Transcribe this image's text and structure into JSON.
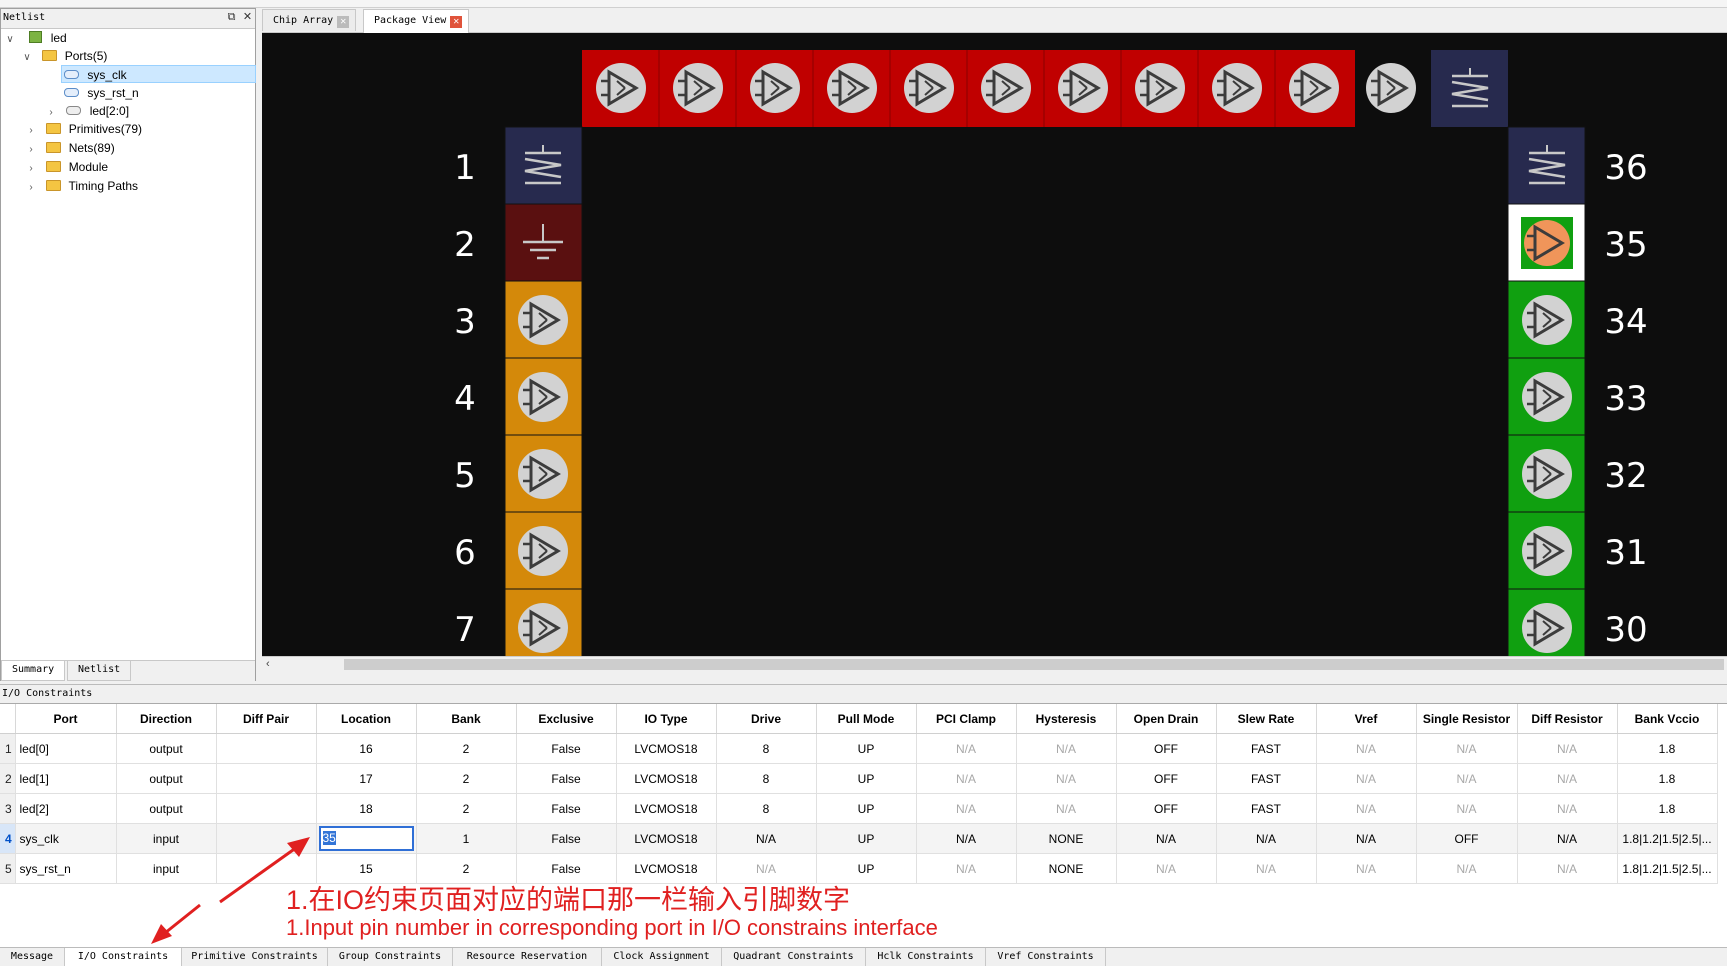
{
  "netlist": {
    "title": "Netlist",
    "tree": [
      {
        "label": "led",
        "icon": "chip-icon"
      },
      {
        "label": "Ports(5)",
        "icon": "folder-icon"
      },
      {
        "label": "sys_clk",
        "icon": "port-icon"
      },
      {
        "label": "sys_rst_n",
        "icon": "port-icon"
      },
      {
        "label": "led[2:0]",
        "icon": "bus-port-icon"
      },
      {
        "label": "Primitives(79)",
        "icon": "folder-icon"
      },
      {
        "label": "Nets(89)",
        "icon": "folder-icon"
      },
      {
        "label": "Module",
        "icon": "folder-icon"
      },
      {
        "label": "Timing Paths",
        "icon": "folder-icon"
      }
    ],
    "tabs": [
      "Summary",
      "Netlist"
    ]
  },
  "view_tabs": [
    "Chip Array",
    "Package View"
  ],
  "package": {
    "left_pins": [
      "1",
      "2",
      "3",
      "4",
      "5",
      "6",
      "7"
    ],
    "right_pins": [
      "36",
      "35",
      "34",
      "33",
      "32",
      "31",
      "30"
    ],
    "colors": {
      "top_io": "#c00000",
      "left_io": "#d4890a",
      "right_io": "#10a010",
      "power": "#272a4e",
      "ground": "#5a1010",
      "selected": "#ffffff",
      "selected_icon": "#f0955a"
    }
  },
  "io": {
    "title": "I/O Constraints",
    "columns": [
      "Port",
      "Direction",
      "Diff Pair",
      "Location",
      "Bank",
      "Exclusive",
      "IO Type",
      "Drive",
      "Pull Mode",
      "PCI Clamp",
      "Hysteresis",
      "Open Drain",
      "Slew Rate",
      "Vref",
      "Single Resistor",
      "Diff Resistor",
      "Bank Vccio"
    ],
    "rows": [
      {
        "num": "1",
        "cells": [
          "led[0]",
          "output",
          "",
          "16",
          "2",
          "False",
          "LVCMOS18",
          "8",
          "UP",
          "N/A",
          "N/A",
          "OFF",
          "FAST",
          "N/A",
          "N/A",
          "N/A",
          "1.8"
        ]
      },
      {
        "num": "2",
        "cells": [
          "led[1]",
          "output",
          "",
          "17",
          "2",
          "False",
          "LVCMOS18",
          "8",
          "UP",
          "N/A",
          "N/A",
          "OFF",
          "FAST",
          "N/A",
          "N/A",
          "N/A",
          "1.8"
        ]
      },
      {
        "num": "3",
        "cells": [
          "led[2]",
          "output",
          "",
          "18",
          "2",
          "False",
          "LVCMOS18",
          "8",
          "UP",
          "N/A",
          "N/A",
          "OFF",
          "FAST",
          "N/A",
          "N/A",
          "N/A",
          "1.8"
        ]
      },
      {
        "num": "4",
        "cells": [
          "sys_clk",
          "input",
          "",
          "35",
          "1",
          "False",
          "LVCMOS18",
          "N/A",
          "UP",
          "N/A",
          "NONE",
          "N/A",
          "N/A",
          "N/A",
          "OFF",
          "N/A",
          "1.8|1.2|1.5|2.5|..."
        ]
      },
      {
        "num": "5",
        "cells": [
          "sys_rst_n",
          "input",
          "",
          "15",
          "2",
          "False",
          "LVCMOS18",
          "N/A",
          "UP",
          "N/A",
          "NONE",
          "N/A",
          "N/A",
          "N/A",
          "N/A",
          "N/A",
          "1.8|1.2|1.5|2.5|..."
        ]
      }
    ],
    "annotation_cn": "1.在IO约束页面对应的端口那一栏输入引脚数字",
    "annotation_en": "1.Input pin number in corresponding port in I/O constrains interface"
  },
  "bottom_tabs": [
    "Message",
    "I/O Constraints",
    "Primitive Constraints",
    "Group Constraints",
    "Resource Reservation",
    "Clock Assignment",
    "Quadrant Constraints",
    "Hclk Constraints",
    "Vref Constraints"
  ]
}
